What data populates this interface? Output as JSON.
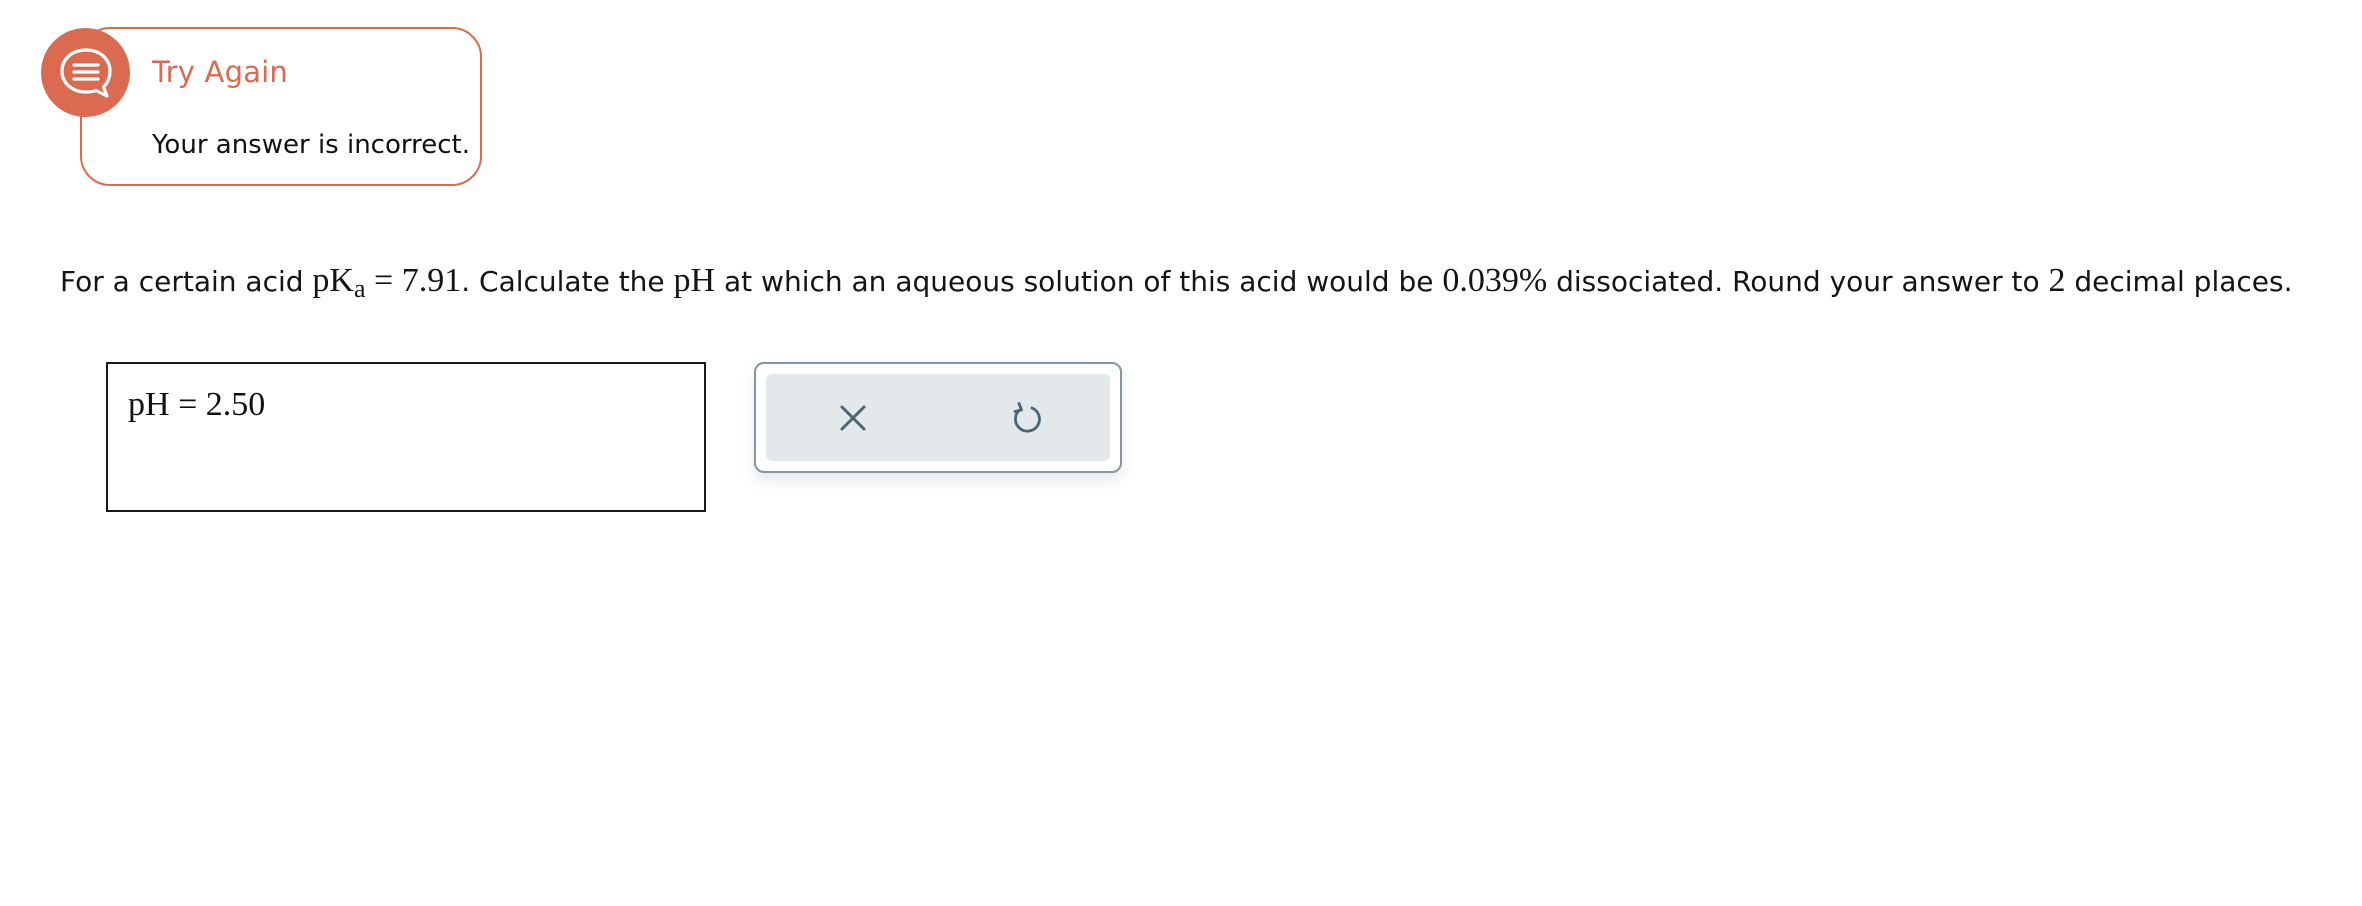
{
  "feedback": {
    "title": "Try Again",
    "message": "Your answer is incorrect.",
    "icon": "chat-bubble-icon",
    "accent_color": "#db6b50"
  },
  "question": {
    "prefix": "For a certain acid ",
    "pka_symbol": "pK",
    "pka_subscript": "a",
    "equals": " = ",
    "pka_value": "7.91",
    "part2": ". Calculate the ",
    "ph_symbol": "pH",
    "part3": " at which an aqueous solution of this acid would be ",
    "percent_value": "0.039%",
    "part4": " dissociated. Round your answer to ",
    "decimal_places": "2",
    "part5": " decimal places."
  },
  "answer": {
    "label": "pH",
    "equals": " = ",
    "value": "2.50"
  },
  "actions": {
    "clear_icon": "close-icon",
    "undo_icon": "undo-icon",
    "panel_color": "#e3e8eb",
    "border_color": "#8596a0"
  }
}
